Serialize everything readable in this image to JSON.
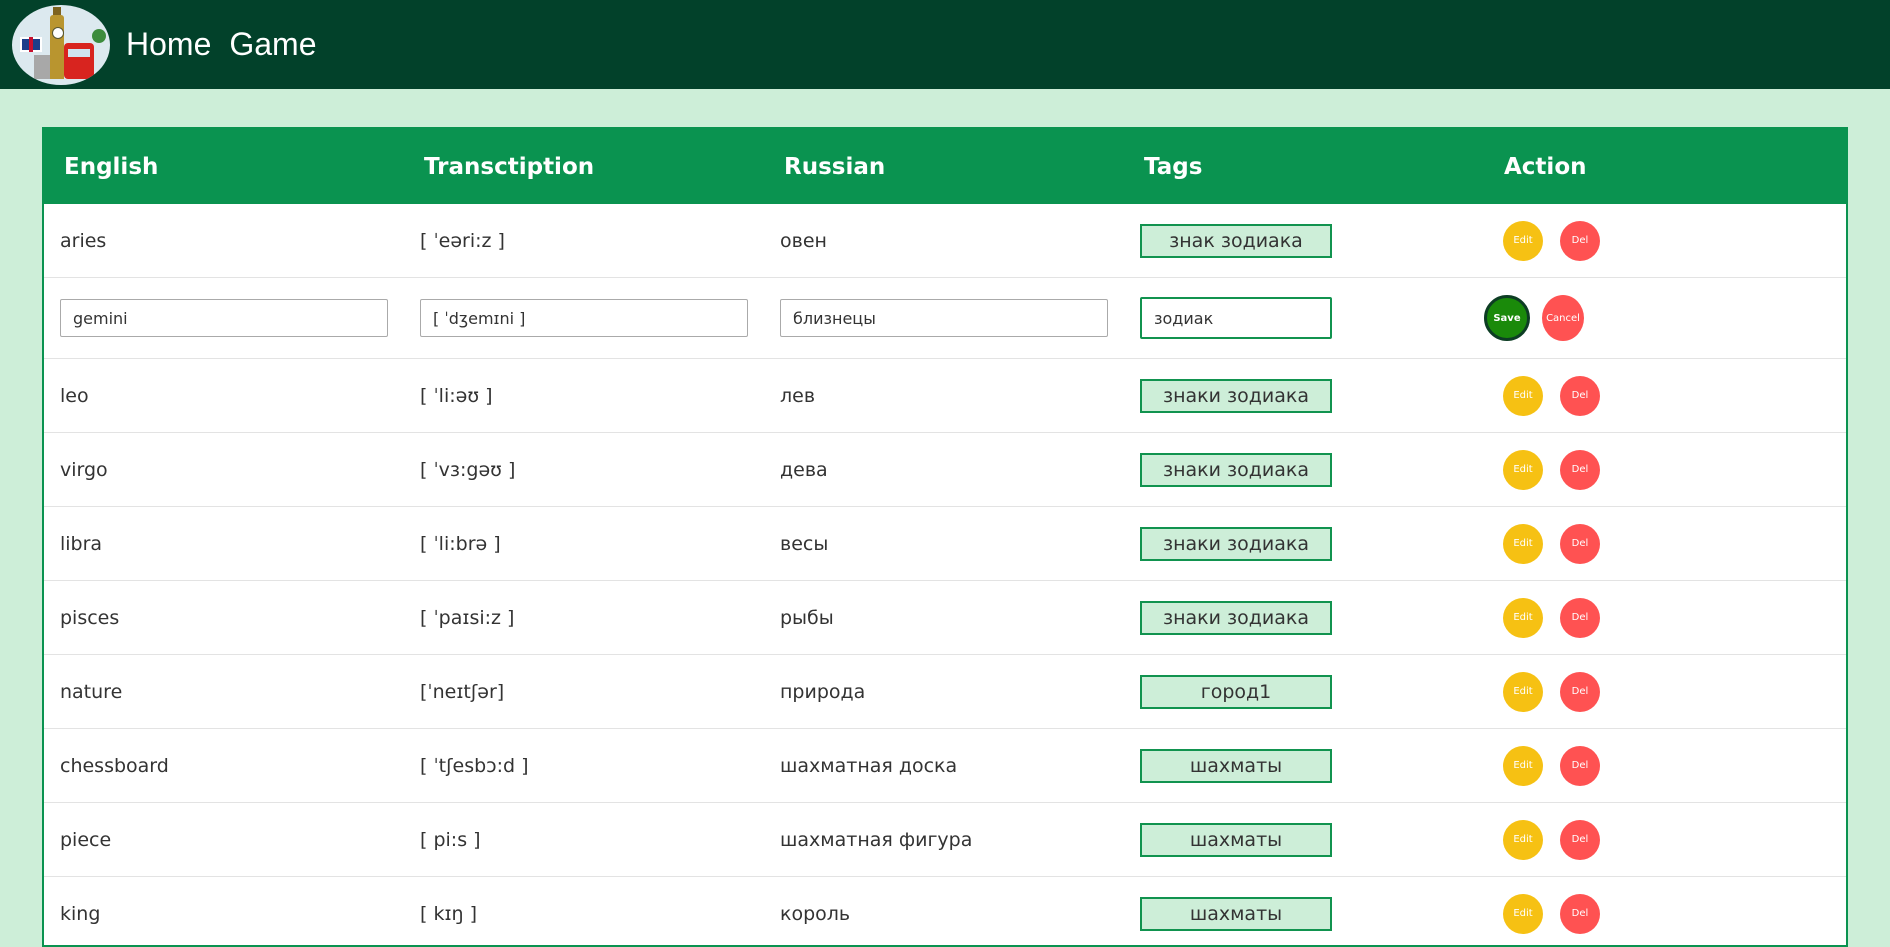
{
  "nav": {
    "home": "Home",
    "game": "Game"
  },
  "table": {
    "headers": {
      "english": "English",
      "transcription": "Transctiption",
      "russian": "Russian",
      "tags": "Tags",
      "action": "Action"
    },
    "edit_label": "Edit",
    "del_label": "Del",
    "save_label": "Save",
    "cancel_label": "Cancel",
    "rows": [
      {
        "english": "aries",
        "transcription": "[ ˈeəri:z ]",
        "russian": "овен",
        "tags": "знак зодиака"
      },
      {
        "english": "gemini",
        "transcription": "[ ˈdʒemɪni ]",
        "russian": "близнецы",
        "tags": "зодиак"
      },
      {
        "english": "leo",
        "transcription": "[ ˈli:əʊ ]",
        "russian": "лев",
        "tags": "знаки зодиака"
      },
      {
        "english": "virgo",
        "transcription": "[ ˈvɜ:gəʊ ]",
        "russian": "дева",
        "tags": "знаки зодиака"
      },
      {
        "english": "libra",
        "transcription": "[ ˈli:brə ]",
        "russian": "весы",
        "tags": "знаки зодиака"
      },
      {
        "english": "pisces",
        "transcription": "[ ˈpaɪsi:z ]",
        "russian": "рыбы",
        "tags": "знаки зодиака"
      },
      {
        "english": "nature",
        "transcription": "[ˈneɪtʃər]",
        "russian": "природа",
        "tags": "город1"
      },
      {
        "english": "chessboard",
        "transcription": "[ ˈtʃesbɔ:d ]",
        "russian": "шахматная доска",
        "tags": "шахматы"
      },
      {
        "english": "piece",
        "transcription": "[ pi:s ]",
        "russian": "шахматная фигура",
        "tags": "шахматы"
      },
      {
        "english": "king",
        "transcription": "[ kɪŋ ]",
        "russian": "король",
        "tags": "шахматы"
      }
    ]
  },
  "colors": {
    "header_bg": "#02412a",
    "table_head": "#0a9350",
    "page_bg": "#cdeed8",
    "edit_btn": "#f6c113",
    "del_btn": "#ff5252",
    "save_btn": "#1a8a0a"
  }
}
